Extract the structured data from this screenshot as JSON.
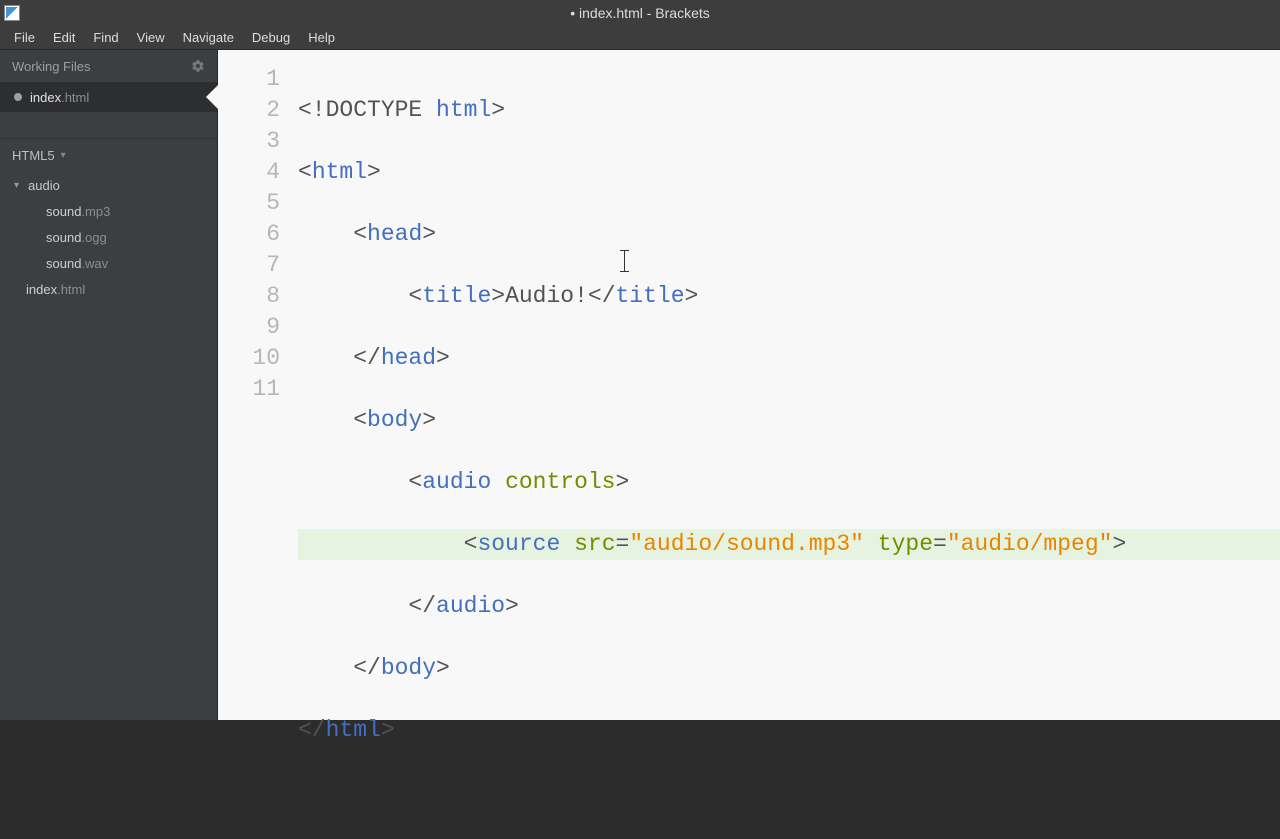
{
  "window": {
    "title": "• index.html - Brackets",
    "modified_indicator": "•"
  },
  "menus": [
    "File",
    "Edit",
    "Find",
    "View",
    "Navigate",
    "Debug",
    "Help"
  ],
  "sidebar": {
    "working_files_label": "Working Files",
    "working_files": [
      {
        "name": "index",
        "ext": ".html",
        "dirty": true,
        "active": true
      }
    ],
    "project_label": "HTML5",
    "tree": {
      "folder": {
        "name": "audio",
        "expanded": true
      },
      "children": [
        {
          "name": "sound",
          "ext": ".mp3"
        },
        {
          "name": "sound",
          "ext": ".ogg"
        },
        {
          "name": "sound",
          "ext": ".wav"
        }
      ],
      "root_files": [
        {
          "name": "index",
          "ext": ".html"
        }
      ]
    }
  },
  "editor": {
    "line_numbers": [
      "1",
      "2",
      "3",
      "4",
      "5",
      "6",
      "7",
      "8",
      "9",
      "10",
      "11"
    ],
    "active_line": 8,
    "code": {
      "l1": {
        "doctype_open": "<!DOCTYPE",
        "doctype_val": " html",
        "close": ">"
      },
      "l2": {
        "open": "<",
        "tag": "html",
        "close": ">"
      },
      "l3": {
        "indent": "    ",
        "open": "<",
        "tag": "head",
        "close": ">"
      },
      "l4": {
        "indent": "        ",
        "open": "<",
        "tag": "title",
        "close": ">",
        "text": "Audio!",
        "open2": "</",
        "tag2": "title",
        "close2": ">"
      },
      "l5": {
        "indent": "    ",
        "open": "</",
        "tag": "head",
        "close": ">"
      },
      "l6": {
        "indent": "    ",
        "open": "<",
        "tag": "body",
        "close": ">"
      },
      "l7": {
        "indent": "        ",
        "open": "<",
        "tag": "audio",
        "sp": " ",
        "attr": "controls",
        "close": ">"
      },
      "l8": {
        "indent": "            ",
        "open": "<",
        "tag": "source",
        "sp1": " ",
        "attr1": "src",
        "eq1": "=",
        "val1": "\"audio/sound.mp3\"",
        "sp2": " ",
        "attr2": "type",
        "eq2": "=",
        "val2": "\"audio/mpeg\"",
        "close": ">"
      },
      "l9": {
        "indent": "        ",
        "open": "</",
        "tag": "audio",
        "close": ">"
      },
      "l10": {
        "indent": "    ",
        "open": "</",
        "tag": "body",
        "close": ">"
      },
      "l11": {
        "open": "</",
        "tag": "html",
        "close": ">"
      }
    }
  }
}
